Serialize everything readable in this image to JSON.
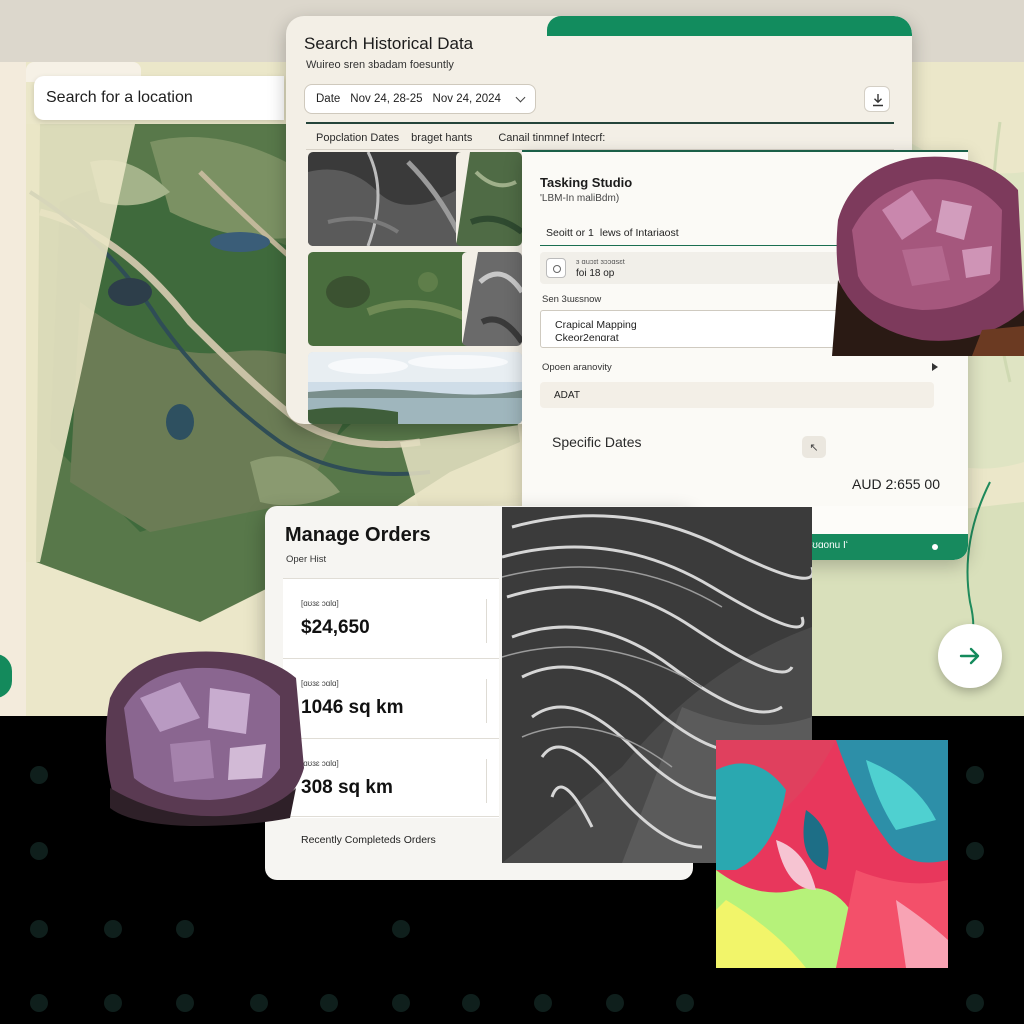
{
  "search_location": {
    "placeholder": "Search for a location"
  },
  "historical": {
    "title": "Search Historical Data",
    "subtitle": "Wuireo sren ɜbadam foesuntly",
    "date_label": "Date",
    "date_from": "Nov 24, 28-25",
    "date_to": "Nov 24, 2024",
    "filters": [
      "Popclation Dates",
      "braget hants",
      "Canail tinmnef Intecrf:"
    ]
  },
  "tasking": {
    "title": "Tasking Studio",
    "subtitle": "'LBM-In maliBdm)",
    "search_text": "Seoitt or 1",
    "search_text2": "lews of Intariaost",
    "row_small": "ɜ ɑuɔɪt ɜɔɔɑsɛt",
    "row_text": "foi 18 op",
    "section_label": "Sen 3ɯɛsnow",
    "map_title": "Crapical Mapping",
    "map_sub": "Ckeor2enɑrat",
    "open_label": "Opoen aranovity",
    "adat_label": "ADAT",
    "specific_dates": "Specific Dates",
    "price": "AUD 2:655 00",
    "footer_label": "ʊɑonu Iʻ"
  },
  "orders": {
    "title": "Manage Orders",
    "subtitle": "Oper Hist",
    "cards": [
      {
        "label": "[ɑʊɜɛ ɔɑlɑ]",
        "value": "$24,650"
      },
      {
        "label": "[ɑʊɜɛ ɔɑlɑ]",
        "value": "1046 sq km"
      },
      {
        "label": "[ɑʊɜɛ ɔɑlɑ]",
        "value": "308 sq km"
      }
    ],
    "footer": "Recently Completeds Orders"
  },
  "icons": {
    "download": "download-icon",
    "next": "arrow-right-icon",
    "chevron": "chevron-down-icon"
  },
  "colors": {
    "accent_green": "#128c5e",
    "panel_cream": "#f3efe6",
    "dark_bg": "#000000"
  }
}
